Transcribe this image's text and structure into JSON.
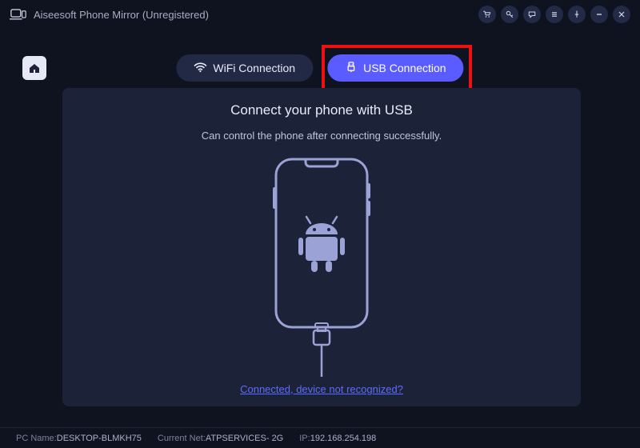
{
  "app": {
    "title": "Aiseesoft Phone Mirror (Unregistered)"
  },
  "titlebar_icons": [
    "cart",
    "key",
    "chat",
    "menu",
    "pin",
    "minimize",
    "close"
  ],
  "tabs": {
    "wifi": "WiFi Connection",
    "usb": "USB Connection"
  },
  "panel": {
    "heading": "Connect your phone with USB",
    "subtext": "Can control the phone after connecting successfully.",
    "help_link": "Connected, device not recognized?"
  },
  "status": {
    "pc_label": "PC Name:",
    "pc_value": "DESKTOP-BLMKH75",
    "net_label": "Current Net:",
    "net_value": "ATPSERVICES- 2G",
    "ip_label": "IP:",
    "ip_value": "192.168.254.198"
  },
  "colors": {
    "accent": "#5a5cff",
    "highlight": "#e11"
  }
}
